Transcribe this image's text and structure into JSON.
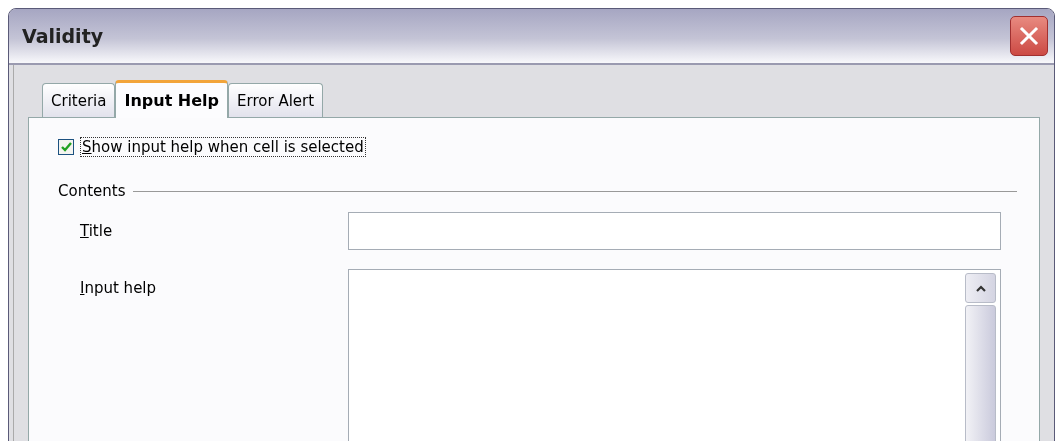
{
  "window": {
    "title": "Validity"
  },
  "tabs": [
    {
      "label": "Criteria",
      "selected": false
    },
    {
      "label": "Input Help",
      "selected": true
    },
    {
      "label": "Error Alert",
      "selected": false
    }
  ],
  "show_help": {
    "label": "Show input help when cell is selected",
    "checked": true
  },
  "contents": {
    "heading": "Contents",
    "title_field": {
      "label": "Title"
    },
    "input_help_field": {
      "label": "Input help"
    }
  }
}
